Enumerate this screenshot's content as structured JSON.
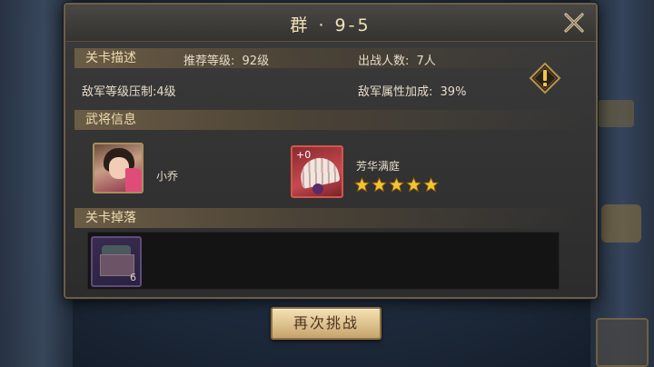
{
  "dialog": {
    "title": "群 · 9-5"
  },
  "sections": {
    "stage_description": "关卡描述",
    "generals_info": "武将信息",
    "stage_drops": "关卡掉落"
  },
  "description": {
    "recommended_level_label": "推荐等级:",
    "recommended_level_value": "92级",
    "troop_count_label": "出战人数:",
    "troop_count_value": "7人",
    "enemy_suppression_label": "敌军等级压制:",
    "enemy_suppression_value": "4级",
    "enemy_attr_bonus_label": "敌军属性加成:",
    "enemy_attr_bonus_value": "39%"
  },
  "generals": {
    "hero_name": "小乔",
    "treasure_level": "+0",
    "treasure_name": "芳华满庭",
    "treasure_stars": 5
  },
  "drops": [
    {
      "icon": "chest-icon",
      "count": "6"
    }
  ],
  "actions": {
    "retry_label": "再次挑战"
  },
  "icons": {
    "close": "close-icon",
    "tip": "exclamation-icon",
    "star": "star-icon"
  },
  "colors": {
    "title_text": "#f2e1b6",
    "header_gold": "#6b5c45",
    "star_gold": "#f4c430",
    "button_gold": "#dcc08c",
    "treasure_border": "#d0584a",
    "drop_border": "#5d4c7c"
  }
}
